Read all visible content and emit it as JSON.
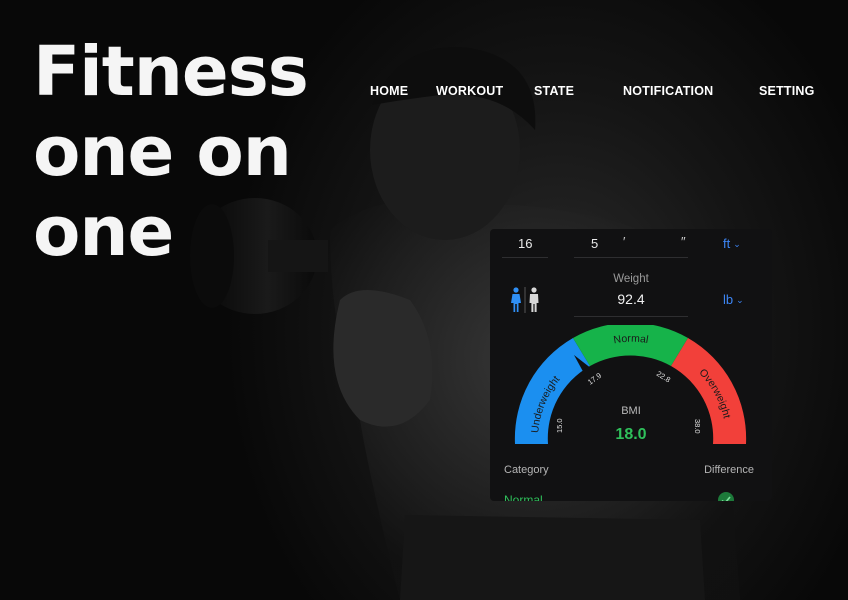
{
  "hero": {
    "line1": "Fitness",
    "line2": "one on",
    "line3": "one"
  },
  "nav": {
    "items": [
      "HOME",
      "WORKOUT",
      "STATE",
      "NOTIFICATION",
      "SETTING"
    ]
  },
  "bmi_panel": {
    "height": {
      "ft": "16",
      "inch": "5",
      "ft_mark": "′",
      "in_mark": "″",
      "unit": "ft"
    },
    "weight": {
      "label": "Weight",
      "value": "92.4",
      "unit": "lb"
    },
    "gauge": {
      "segments": [
        "Underweight",
        "Normal",
        "Overweight"
      ],
      "ticks": [
        "15.0",
        "17.9",
        "22.8",
        "38.0"
      ],
      "colors": {
        "underweight": "#1b8ff0",
        "normal": "#16b34a",
        "overweight": "#f2403a"
      }
    },
    "bmi_label": "BMI",
    "bmi_value": "18.0",
    "category_label": "Category",
    "difference_label": "Difference",
    "category_value": "Normal"
  },
  "icons": [
    "female-icon",
    "male-icon",
    "chevron-down-icon",
    "check-icon"
  ]
}
